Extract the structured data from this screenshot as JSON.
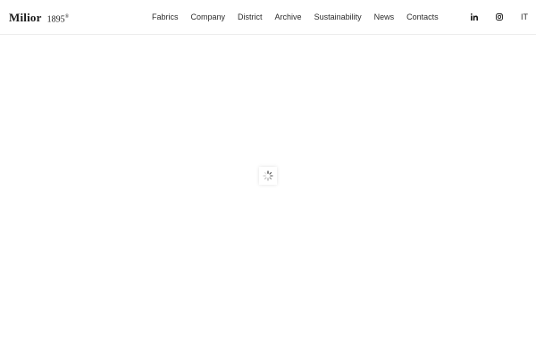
{
  "brand": {
    "name": "Milior",
    "year": "1895",
    "registered": "®"
  },
  "nav": {
    "items": [
      {
        "label": "Fabrics"
      },
      {
        "label": "Company"
      },
      {
        "label": "District"
      },
      {
        "label": "Archive"
      },
      {
        "label": "Sustainability"
      },
      {
        "label": "News"
      },
      {
        "label": "Contacts"
      }
    ]
  },
  "social": {
    "linkedin_icon": "linkedin-icon",
    "instagram_icon": "instagram-icon"
  },
  "language": {
    "current": "IT"
  },
  "loader": {
    "icon": "spinner-icon"
  },
  "colors": {
    "text": "#2b2b2b",
    "border": "#ececec",
    "background": "#ffffff"
  }
}
